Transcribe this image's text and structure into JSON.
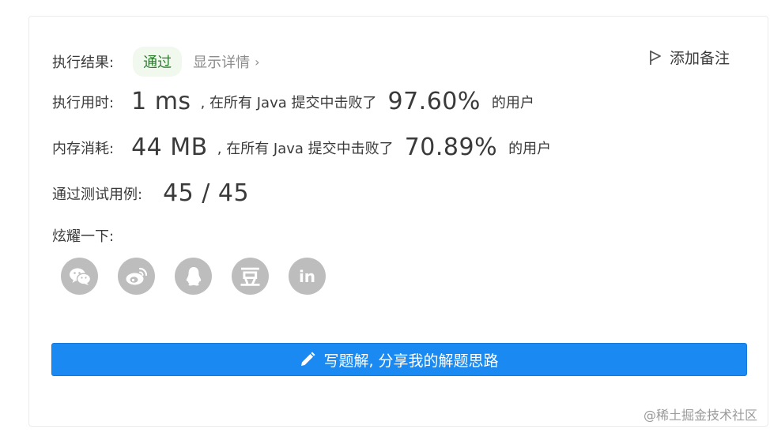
{
  "result": {
    "label": "执行结果:",
    "status": "通过",
    "details": "显示详情",
    "details_chevron": "›",
    "add_note": "添加备注"
  },
  "runtime": {
    "label": "执行用时:",
    "value": "1 ms",
    "sep": ", 在所有 Java 提交中击败了",
    "percent": "97.60%",
    "suffix": "的用户"
  },
  "memory": {
    "label": "内存消耗:",
    "value": "44 MB",
    "sep": ", 在所有 Java 提交中击败了",
    "percent": "70.89%",
    "suffix": "的用户"
  },
  "tests": {
    "label": "通过测试用例:",
    "value": "45 / 45"
  },
  "share": {
    "label": "炫耀一下:",
    "icons": [
      "wechat-icon",
      "weibo-icon",
      "qq-icon",
      "douban-icon",
      "linkedin-icon"
    ],
    "douban_glyph": "豆",
    "linkedin_glyph": "in"
  },
  "solution_button": {
    "label": "写题解, 分享我的解题思路"
  },
  "watermark": "@稀土掘金技术社区",
  "colors": {
    "accent": "#1a89f2",
    "pass_bg": "#f1f8ee",
    "pass_text": "#2c7a2c",
    "icon_bg": "#bdbdbd"
  }
}
